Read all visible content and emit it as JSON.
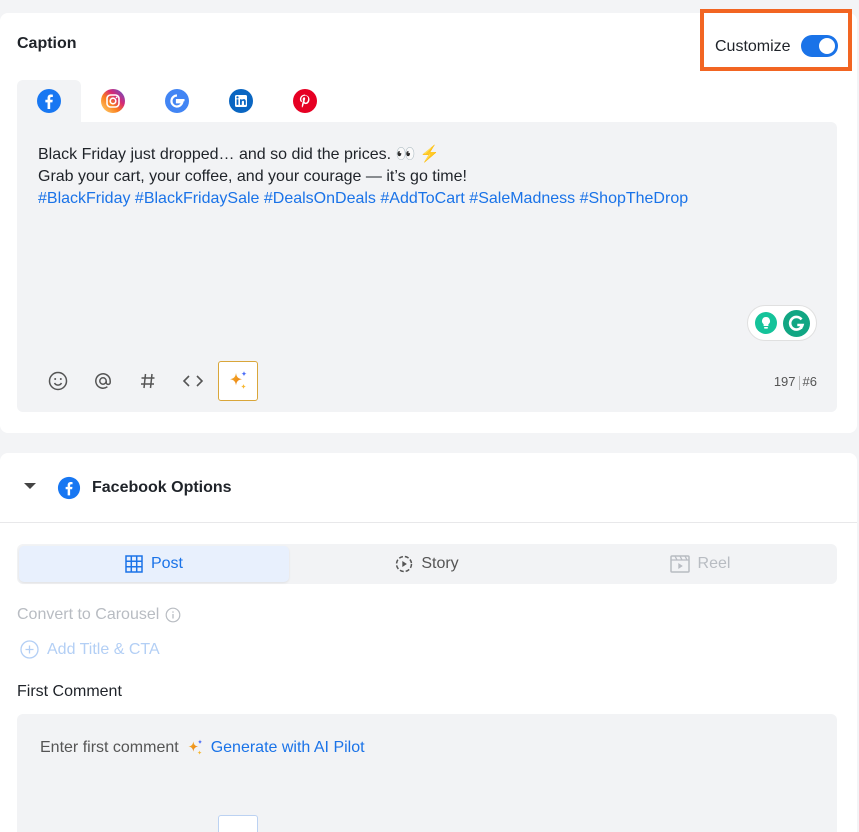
{
  "caption": {
    "title": "Caption",
    "customize_label": "Customize",
    "customize_enabled": true,
    "highlight_color": "#f26522",
    "tabs": [
      {
        "name": "facebook",
        "icon": "facebook-icon",
        "active": true
      },
      {
        "name": "instagram",
        "icon": "instagram-icon",
        "active": false
      },
      {
        "name": "google",
        "icon": "google-icon",
        "active": false
      },
      {
        "name": "linkedin",
        "icon": "linkedin-icon",
        "active": false
      },
      {
        "name": "pinterest",
        "icon": "pinterest-icon",
        "active": false
      }
    ],
    "text_line1": "Black Friday just dropped… and so did the prices. 👀 ⚡",
    "text_line2": "Grab your cart, your coffee, and your courage — it’s go time!",
    "hashtags": "#BlackFriday #BlackFridaySale #DealsOnDeals #AddToCart #SaleMadness #ShopTheDrop",
    "toolbar": [
      {
        "name": "emoji",
        "icon": "smiley-icon"
      },
      {
        "name": "mention",
        "icon": "at-icon"
      },
      {
        "name": "hashtag",
        "icon": "hash-icon"
      },
      {
        "name": "code",
        "icon": "code-icon"
      },
      {
        "name": "ai",
        "icon": "sparkle-icon"
      }
    ],
    "char_count": "197",
    "hashtag_count": "#6"
  },
  "facebook_options": {
    "title": "Facebook Options",
    "post_types": [
      {
        "label": "Post",
        "icon": "grid-icon",
        "active": true
      },
      {
        "label": "Story",
        "icon": "story-icon",
        "active": false
      },
      {
        "label": "Reel",
        "icon": "reel-icon",
        "active": false,
        "disabled": true
      }
    ],
    "convert_to_carousel": "Convert to Carousel",
    "add_title_cta": "Add Title & CTA",
    "first_comment_label": "First Comment",
    "first_comment_placeholder": "Enter first comment",
    "generate_ai": "Generate with AI Pilot"
  },
  "colors": {
    "accent": "#1a73e8",
    "facebook": "#1877f2",
    "linkedin": "#0a66c2",
    "pinterest": "#e60023",
    "grammarly": "#15c39a"
  }
}
